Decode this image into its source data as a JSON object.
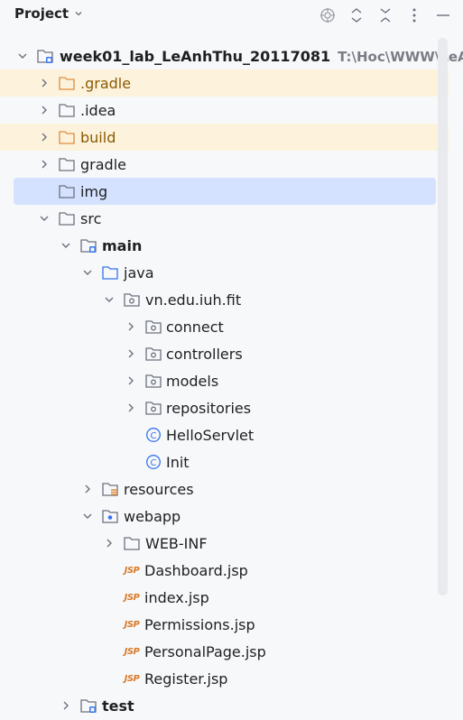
{
  "header": {
    "title": "Project",
    "actions": [
      "crosshair-icon",
      "expand-icon",
      "collapse-icon",
      "more-icon",
      "hide-icon"
    ]
  },
  "tree": {
    "root_label": "week01_lab_LeAnhThu_20117081",
    "root_path": "T:\\Hoc\\WWW\\LeAn",
    "gradle_hidden": ".gradle",
    "idea": ".idea",
    "build": "build",
    "gradle": "gradle",
    "img": "img",
    "src": "src",
    "main": "main",
    "java": "java",
    "package": "vn.edu.iuh.fit",
    "connect": "connect",
    "controllers": "controllers",
    "models": "models",
    "repositories": "repositories",
    "hello": "HelloServlet",
    "init": "Init",
    "resources": "resources",
    "webapp": "webapp",
    "webinf": "WEB-INF",
    "dashboard": "Dashboard.jsp",
    "index": "index.jsp",
    "permissions": "Permissions.jsp",
    "personal": "PersonalPage.jsp",
    "register": "Register.jsp",
    "test": "test",
    "jsp_badge": "JSP",
    "class_badge": "C"
  }
}
